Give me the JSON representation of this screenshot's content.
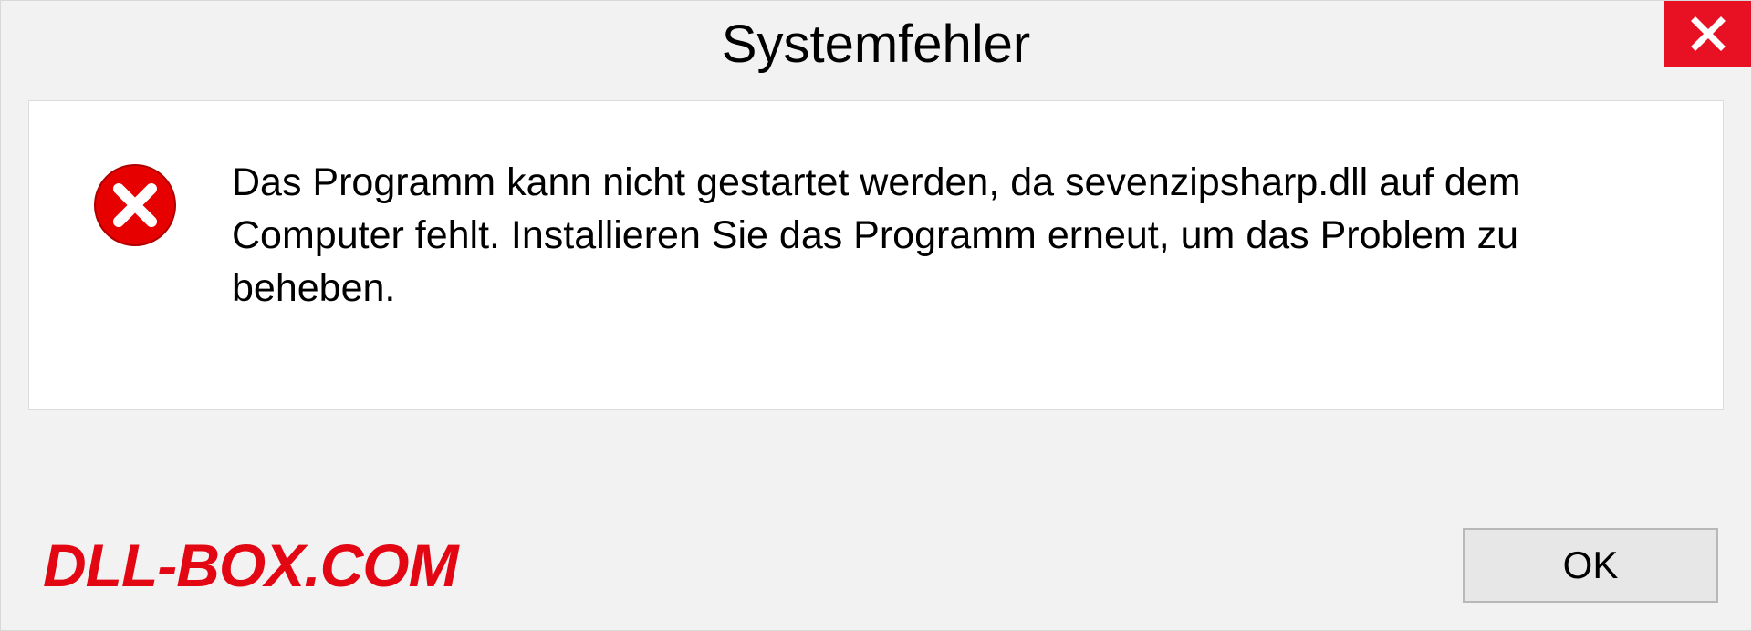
{
  "dialog": {
    "title": "Systemfehler",
    "message": "Das Programm kann nicht gestartet werden, da sevenzipsharp.dll auf dem Computer fehlt. Installieren Sie das Programm erneut, um das Problem zu beheben.",
    "ok_label": "OK"
  },
  "watermark": "DLL-BOX.COM"
}
